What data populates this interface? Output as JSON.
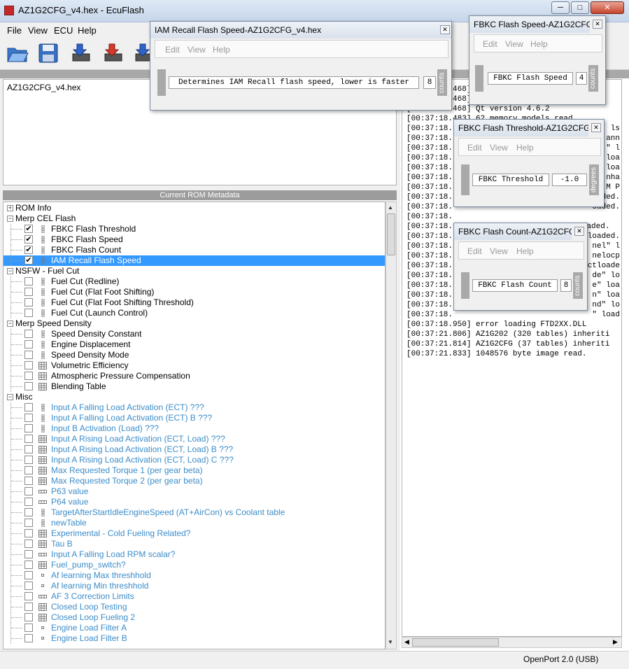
{
  "window": {
    "title": "AZ1G2CFG_v4.hex - EcuFlash",
    "min": "─",
    "max": "□",
    "close": "✕"
  },
  "menu": [
    "File",
    "View",
    "ECU",
    "Help"
  ],
  "toolbar": {
    "icons": [
      "open-icon",
      "save-icon",
      "read-ecu-icon",
      "write-ecu-icon",
      "test-write-icon"
    ]
  },
  "file_list": [
    "AZ1G2CFG_v4.hex"
  ],
  "metadata_header": "Current ROM Metadata",
  "tree": [
    {
      "type": "cat",
      "label": "ROM Info",
      "exp": "+"
    },
    {
      "type": "cat",
      "label": "Merp CEL Flash",
      "exp": "−"
    },
    {
      "type": "item",
      "label": "FBKC Flash Threshold",
      "checked": true,
      "icon": "scalar"
    },
    {
      "type": "item",
      "label": "FBKC Flash Speed",
      "checked": true,
      "icon": "scalar"
    },
    {
      "type": "item",
      "label": "FBKC Flash Count",
      "checked": true,
      "icon": "scalar"
    },
    {
      "type": "item",
      "label": "IAM Recall Flash Speed",
      "checked": true,
      "icon": "scalar",
      "selected": true
    },
    {
      "type": "cat",
      "label": "NSFW - Fuel Cut",
      "exp": "−"
    },
    {
      "type": "item",
      "label": "Fuel Cut (Redline)",
      "icon": "scalar"
    },
    {
      "type": "item",
      "label": "Fuel Cut (Flat Foot Shifting)",
      "icon": "scalar"
    },
    {
      "type": "item",
      "label": "Fuel Cut (Flat Foot Shifting Threshold)",
      "icon": "scalar"
    },
    {
      "type": "item",
      "label": "Fuel Cut (Launch Control)",
      "icon": "scalar"
    },
    {
      "type": "cat",
      "label": "Merp Speed Density",
      "exp": "−"
    },
    {
      "type": "item",
      "label": "Speed Density Constant",
      "icon": "scalar"
    },
    {
      "type": "item",
      "label": "Engine Displacement",
      "icon": "scalar"
    },
    {
      "type": "item",
      "label": "Speed Density Mode",
      "icon": "scalar"
    },
    {
      "type": "item",
      "label": "Volumetric Efficiency",
      "icon": "table"
    },
    {
      "type": "item",
      "label": "Atmospheric Pressure Compensation",
      "icon": "table"
    },
    {
      "type": "item",
      "label": "Blending Table",
      "icon": "table"
    },
    {
      "type": "cat",
      "label": "Misc",
      "exp": "−"
    },
    {
      "type": "item",
      "label": "Input A Falling Load Activation (ECT) ???",
      "icon": "scalar",
      "blue": true
    },
    {
      "type": "item",
      "label": "Input A Falling Load Activation (ECT) B ???",
      "icon": "scalar",
      "blue": true
    },
    {
      "type": "item",
      "label": "Input B Activation (Load) ???",
      "icon": "scalar",
      "blue": true
    },
    {
      "type": "item",
      "label": "Input A Rising Load Activation (ECT, Load) ???",
      "icon": "table",
      "blue": true
    },
    {
      "type": "item",
      "label": "Input A Rising Load Activation (ECT, Load) B ???",
      "icon": "table",
      "blue": true
    },
    {
      "type": "item",
      "label": "Input A Rising Load Activation (ECT, Load) C ???",
      "icon": "table",
      "blue": true
    },
    {
      "type": "item",
      "label": "Max Requested Torque 1 (per gear beta)",
      "icon": "table",
      "blue": true
    },
    {
      "type": "item",
      "label": "Max Requested Torque 2 (per gear beta)",
      "icon": "table",
      "blue": true
    },
    {
      "type": "item",
      "label": "P63 value",
      "icon": "row",
      "blue": true
    },
    {
      "type": "item",
      "label": "P64 value",
      "icon": "row",
      "blue": true
    },
    {
      "type": "item",
      "label": "TargetAfterStartIdleEngineSpeed (AT+AirCon) vs Coolant table",
      "icon": "scalar",
      "blue": true
    },
    {
      "type": "item",
      "label": "newTable",
      "icon": "scalar",
      "blue": true
    },
    {
      "type": "item",
      "label": "Experimental - Cold Fueling Related?",
      "icon": "table",
      "blue": true
    },
    {
      "type": "item",
      "label": "Tau B",
      "icon": "table",
      "blue": true
    },
    {
      "type": "item",
      "label": "Input A Falling Load RPM scalar?",
      "icon": "row",
      "blue": true
    },
    {
      "type": "item",
      "label": "Fuel_pump_switch?",
      "icon": "table",
      "blue": true
    },
    {
      "type": "item",
      "label": "Af learning Max threshhold",
      "icon": "dot",
      "blue": true
    },
    {
      "type": "item",
      "label": "Af learning Min threshhold",
      "icon": "dot",
      "blue": true
    },
    {
      "type": "item",
      "label": "AF 3 Correction Limits",
      "icon": "row",
      "blue": true
    },
    {
      "type": "item",
      "label": "Closed Loop Testing",
      "icon": "table",
      "blue": true
    },
    {
      "type": "item",
      "label": "Closed Loop Fueling 2",
      "icon": "table",
      "blue": true
    },
    {
      "type": "item",
      "label": "Engine Load Filter A",
      "icon": "dot",
      "blue": true
    },
    {
      "type": "item",
      "label": "Engine Load Filter B",
      "icon": "dot",
      "blue": true
    }
  ],
  "log": [
    "[00:37:18.468]",
    "[00:37:18.468]",
    "[00:37:18.468] Qt version 4.6.2",
    "[00:37:18.483] 62 memory models read.",
    "[00:37:18.",
    "[00:37:18.",
    "[00:37:18.",
    "[00:37:18.",
    "[00:37:18.",
    "[00:37:18.",
    "[00:37:18.",
    "[00:37:18.",
    "[00:37:18.",
    "[00:37:18.",
    "[00:37:18.936] flashing tool \"sti04\" loaded.",
    "[00:37:18.",
    "[00:37:18.",
    "[00:37:18.",
    "[00:37:18.",
    "[00:37:18.",
    "[00:37:18.",
    "[00:37:18.",
    "[00:37:18.",
    "[00:37:18.",
    "[00:37:18.950] error loading FTD2XX.DLL",
    "[00:37:21.806] AZ1G202 (320 tables) inheriti",
    "[00:37:21.814] AZ1G2CFG (37 tables) inheriti",
    "[00:37:21.833] 1048576 byte image read."
  ],
  "log_frag": [
    {
      "row": 4,
      "text": "ls"
    },
    {
      "row": 5,
      "text": "ann"
    },
    {
      "row": 6,
      "text": "\" l"
    },
    {
      "row": 7,
      "text": "loa"
    },
    {
      "row": 8,
      "text": "loa"
    },
    {
      "row": 9,
      "text": "nha"
    },
    {
      "row": 10,
      "text": "M P"
    },
    {
      "row": 11,
      "text": "oaded."
    },
    {
      "row": 12,
      "text": "oaded."
    },
    {
      "row": 15,
      "text": "loaded."
    },
    {
      "row": 16,
      "text": "nel\" l"
    },
    {
      "row": 17,
      "text": "nelocp"
    },
    {
      "row": 18,
      "text": "ctloade"
    },
    {
      "row": 19,
      "text": "de\" lo"
    },
    {
      "row": 20,
      "text": "e\" loa"
    },
    {
      "row": 21,
      "text": "n\" loa"
    },
    {
      "row": 22,
      "text": "nd\" lo"
    },
    {
      "row": 23,
      "text": "\" load"
    }
  ],
  "status": "OpenPort 2.0 (USB)",
  "dialogs": {
    "iam": {
      "title": "IAM Recall Flash Speed-AZ1G2CFG_v4.hex",
      "menu": [
        "Edit",
        "View",
        "Help"
      ],
      "desc": "Determines IAM Recall flash speed, lower is faster",
      "value": "8",
      "unit": "counts"
    },
    "speed": {
      "title": "FBKC Flash Speed-AZ1G2CFG_v4.hex",
      "menu": [
        "Edit",
        "View",
        "Help"
      ],
      "desc": "FBKC Flash Speed",
      "value": "4",
      "unit": "counts"
    },
    "threshold": {
      "title": "FBKC Flash Threshold-AZ1G2CFG_v4.hex",
      "menu": [
        "Edit",
        "View",
        "Help"
      ],
      "desc": "FBKC Threshold",
      "value": "-1.0",
      "unit": "degrees"
    },
    "count": {
      "title": "FBKC Flash Count-AZ1G2CFG_v4.hex",
      "menu": [
        "Edit",
        "View",
        "Help"
      ],
      "desc": "FBKC Flash Count",
      "value": "8",
      "unit": "counts"
    }
  },
  "colors": {
    "selection": "#3399ff",
    "meta_link": "#3c8dc9"
  }
}
